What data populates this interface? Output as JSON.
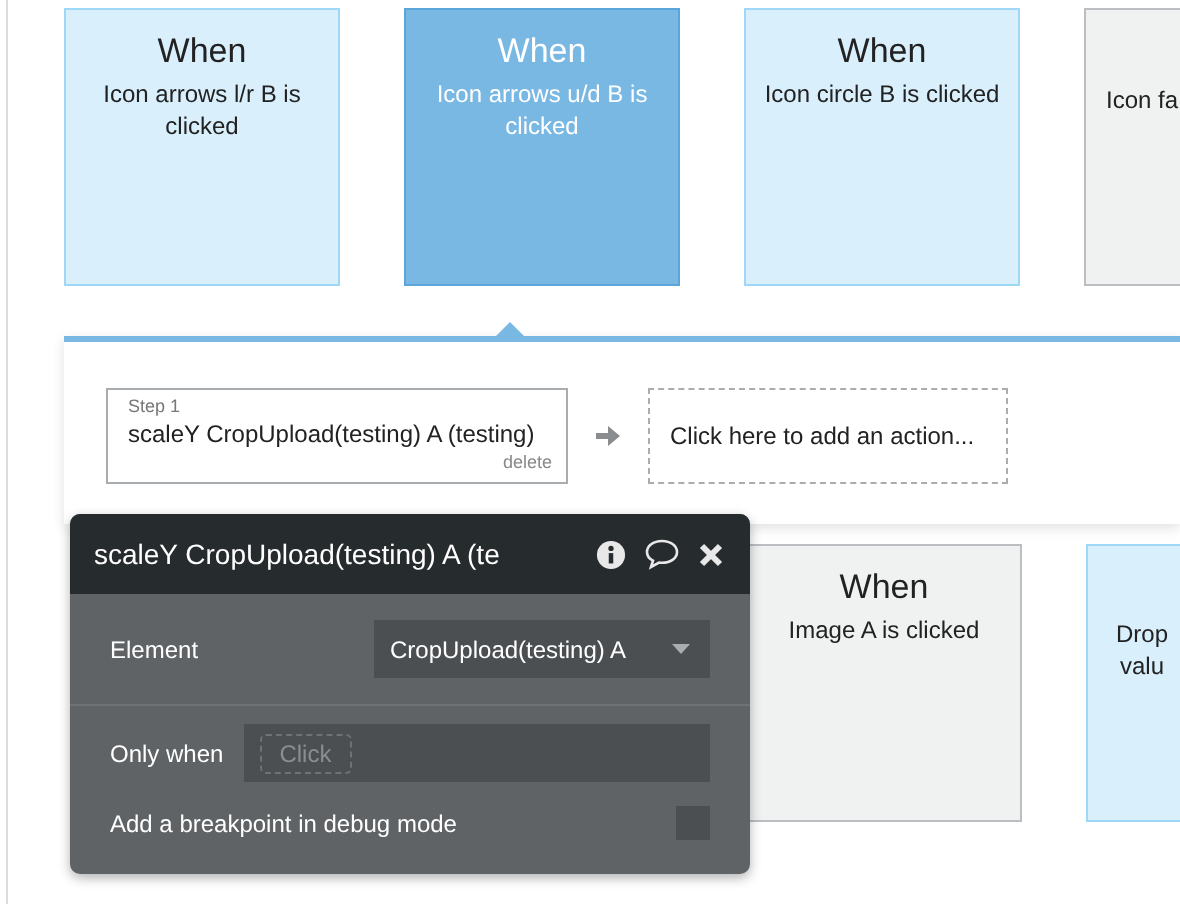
{
  "top_events": [
    {
      "title": "When",
      "text": "Icon arrows l/r B is clicked",
      "selected": false,
      "color": "#d9effc"
    },
    {
      "title": "When",
      "text": "Icon arrows u/d B is clicked",
      "selected": true,
      "color": "#7ab8e4"
    },
    {
      "title": "When",
      "text": "Icon circle B is clicked",
      "selected": false,
      "color": "#d9effc"
    },
    {
      "text": "Icon fa",
      "selected": false,
      "color": "#f0f1f1"
    }
  ],
  "workflow": {
    "steps": [
      {
        "step_label": "Step 1",
        "action": "scaleY CropUpload(testing) A (testing)",
        "delete": "delete"
      }
    ],
    "add_action": "Click here to add an action..."
  },
  "bottom_events": [
    {
      "title": "When",
      "text": "Image A is clicked",
      "selected": false,
      "color": "#f0f1f1"
    },
    {
      "text": "Drop valu",
      "selected": false,
      "color": "#d9effc"
    }
  ],
  "popup": {
    "title": "scaleY CropUpload(testing) A (te",
    "element_label": "Element",
    "element_value": "CropUpload(testing) A",
    "only_when_label": "Only when",
    "only_when_placeholder": "Click",
    "breakpoint_label": "Add a breakpoint in debug mode",
    "breakpoint_checked": false
  }
}
